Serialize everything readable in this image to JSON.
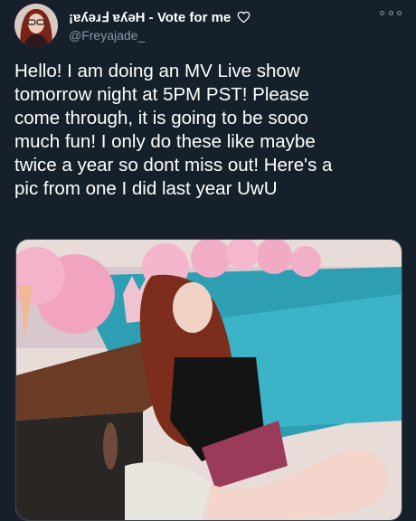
{
  "tweet": {
    "display_name": "Hey! Freya! - Vote for me",
    "display_name_mirrored": "¡ɐʎǝɹℲ ɐʎǝH",
    "name_suffix": " - Vote for me",
    "handle": "@Freyajade_",
    "text": "Hello! I am doing an MV Live show\ntomorrow night at 5PM PST! Please\ncome through, it is going to be sooo\nmuch fun! I only do these like maybe\ntwice a year so dont miss out! Here's a\npic from one I did last year UwU",
    "icons": {
      "heart": "heart-outline-icon",
      "more": "more-options-icon"
    }
  },
  "colors": {
    "background": "#15202b",
    "secondary_text": "#8899a6",
    "border": "#38444d"
  }
}
